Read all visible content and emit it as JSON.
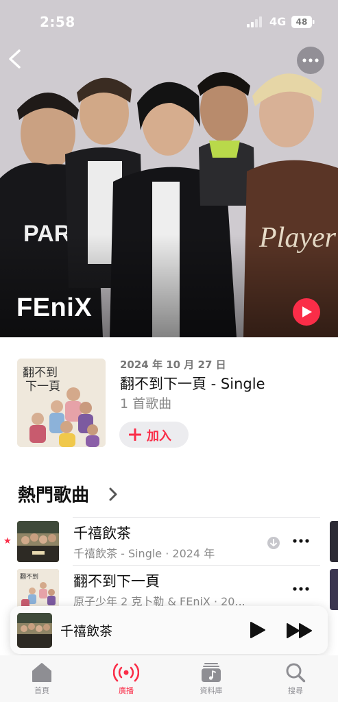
{
  "status_bar": {
    "time": "2:58",
    "network": "4G",
    "battery": "48"
  },
  "artist": {
    "name": "FEniX"
  },
  "latest_release": {
    "date": "2024 年 10 月 27 日",
    "title": "翻不到下一頁 - Single",
    "track_count": "1 首歌曲",
    "add_label": "加入"
  },
  "top_songs": {
    "title": "熱門歌曲",
    "songs": [
      {
        "title": "千禧飲茶",
        "subtitle": "千禧飲茶 - Single · 2024 年",
        "popular_mark": "★"
      },
      {
        "title": "翻不到下一頁",
        "subtitle": "原子少年 2 克卜勒 & FEniX · 20..."
      }
    ]
  },
  "now_playing": {
    "title": "千禧飲茶"
  },
  "tabs": [
    {
      "label": "首頁",
      "icon": "home-icon"
    },
    {
      "label": "廣播",
      "icon": "radio-icon"
    },
    {
      "label": "資料庫",
      "icon": "library-icon"
    },
    {
      "label": "搜尋",
      "icon": "search-icon"
    }
  ],
  "colors": {
    "accent": "#fa2d48",
    "secondary_text": "#888888"
  }
}
